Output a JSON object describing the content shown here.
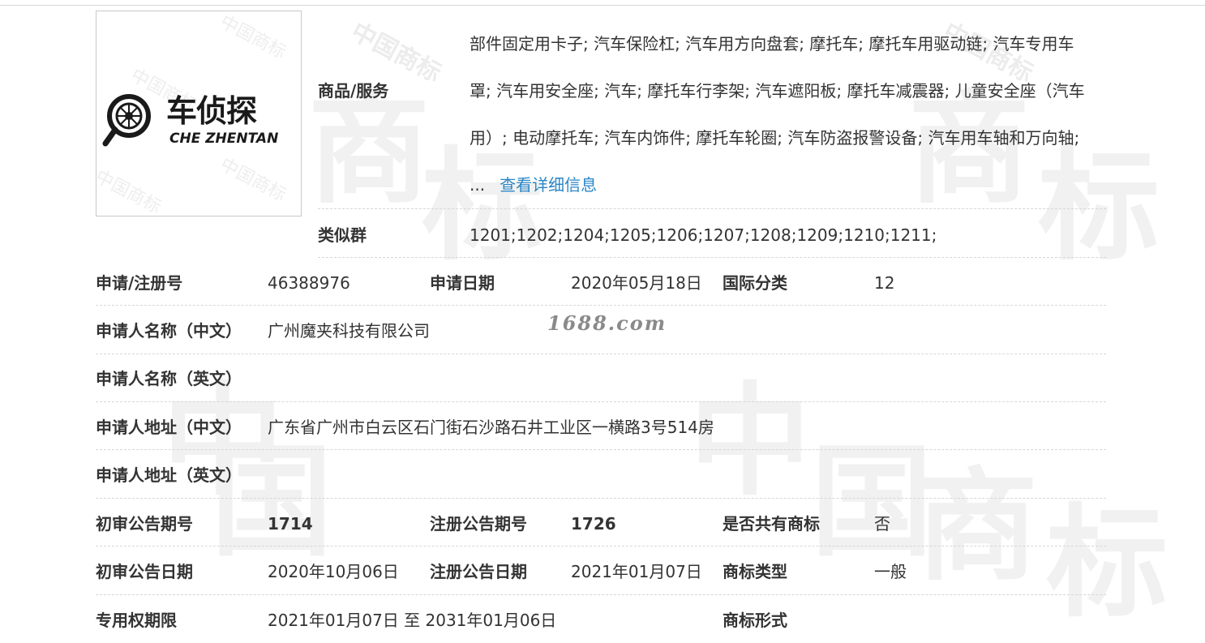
{
  "logo": {
    "brand_cn": "车侦探",
    "brand_en": "CHE ZHENTAN",
    "watermark": [
      "中国商标",
      "中国商标",
      "中国商标",
      "中国商标"
    ]
  },
  "goods": {
    "label": "商品/服务",
    "lines": [
      "部件固定用卡子; 汽车保险杠; 汽车用方向盘套; 摩托车; 摩托车用驱动链; 汽车专用车",
      "罩; 汽车用安全座; 汽车; 摩托车行李架; 汽车遮阳板; 摩托车减震器; 儿童安全座（汽车",
      "用）; 电动摩托车; 汽车内饰件; 摩托车轮圈; 汽车防盗报警设备; 汽车用车轴和万向轴;",
      "..."
    ],
    "detail_link": "查看详细信息"
  },
  "similar_group": {
    "label": "类似群",
    "value": "1201;1202;1204;1205;1206;1207;1208;1209;1210;1211;"
  },
  "rows": {
    "reg_no": {
      "label": "申请/注册号",
      "value": "46388976"
    },
    "apply_date": {
      "label": "申请日期",
      "value": "2020年05月18日"
    },
    "intl_class": {
      "label": "国际分类",
      "value": "12"
    },
    "applicant_cn": {
      "label": "申请人名称（中文）",
      "value": "广州魔夹科技有限公司"
    },
    "applicant_en": {
      "label": "申请人名称（英文）",
      "value": ""
    },
    "address_cn": {
      "label": "申请人地址（中文）",
      "value": "广东省广州市白云区石门街石沙路石井工业区一横路3号514房"
    },
    "address_en": {
      "label": "申请人地址（英文）",
      "value": ""
    },
    "prelim_issue": {
      "label": "初审公告期号",
      "value": "1714"
    },
    "reg_issue": {
      "label": "注册公告期号",
      "value": "1726"
    },
    "shared_mark": {
      "label": "是否共有商标",
      "value": "否"
    },
    "prelim_date": {
      "label": "初审公告日期",
      "value": "2020年10月06日"
    },
    "reg_date": {
      "label": "注册公告日期",
      "value": "2021年01月07日"
    },
    "mark_type": {
      "label": "商标类型",
      "value": "一般"
    },
    "exclusive_period": {
      "label": "专用权期限",
      "value": "2021年01月07日 至 2031年01月06日"
    },
    "mark_form": {
      "label": "商标形式",
      "value": ""
    }
  },
  "site_watermark": "1688.com",
  "bg_watermark": [
    "中",
    "国",
    "商",
    "标"
  ],
  "colors": {
    "link": "#2a86c6",
    "text": "#333333",
    "border": "#d6d6d6"
  }
}
